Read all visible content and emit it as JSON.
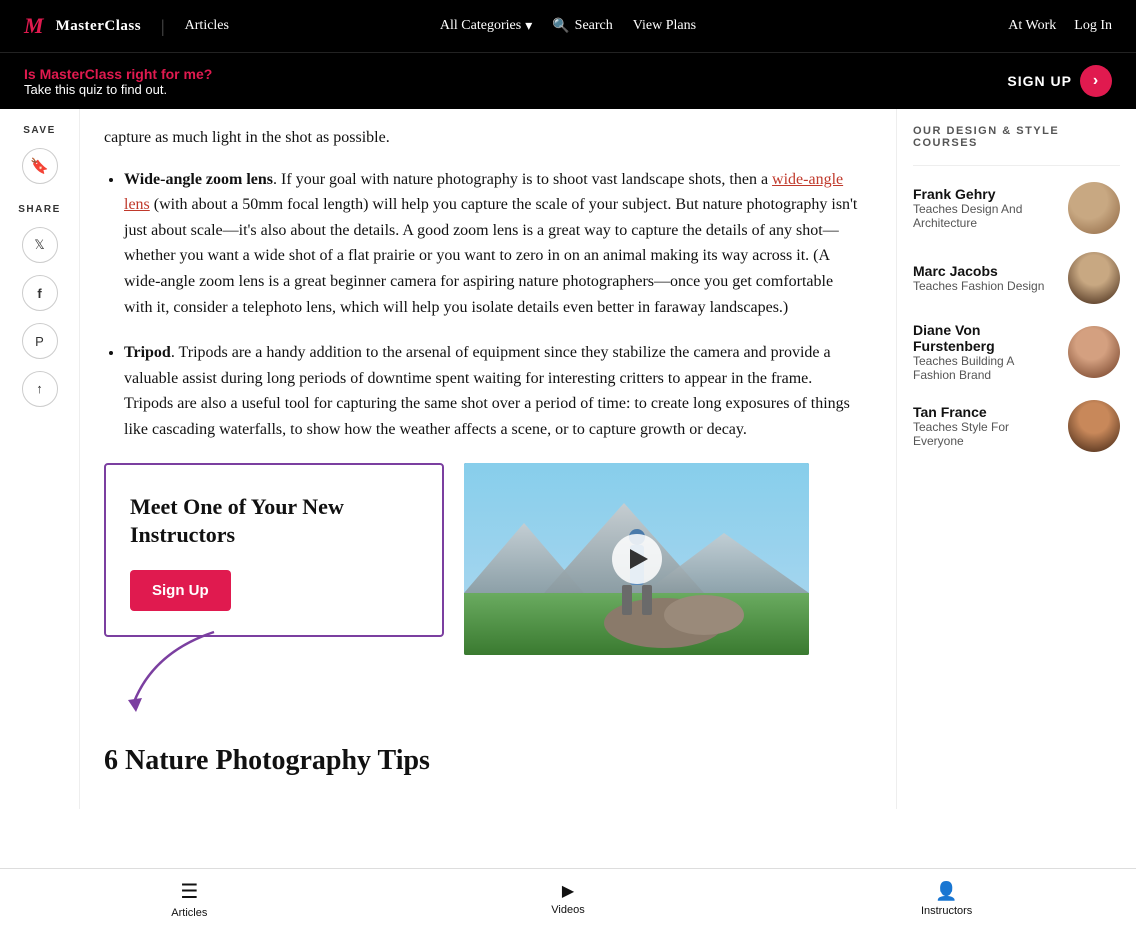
{
  "nav": {
    "logo_m": "M",
    "logo_brand": "MasterClass",
    "logo_divider": "|",
    "logo_section": "Articles",
    "all_categories": "All Categories",
    "search": "Search",
    "view_plans": "View Plans",
    "at_work": "At Work",
    "log_in": "Log In"
  },
  "promo": {
    "question": "Is MasterClass right for me?",
    "subtext": "Take this quiz to find out.",
    "signup_label": "SIGN UP"
  },
  "left_sidebar": {
    "save_label": "SAVE",
    "share_label": "SHARE"
  },
  "article": {
    "items": [
      {
        "title": "Wide-angle zoom lens",
        "body": ". If your goal with nature photography is to shoot vast landscape shots, then a ",
        "link_text": "wide-angle lens",
        "body2": " (with about a 50mm focal length) will help you capture the scale of your subject. But nature photography isn't just about scale—it's also about the details. A good zoom lens is a great way to capture the details of any shot—whether you want a wide shot of a flat prairie or you want to zero in on an animal making its way across it. (A wide-angle zoom lens is a great beginner camera for aspiring nature photographers—once you get comfortable with it, consider a telephoto lens, which will help you isolate details even better in faraway landscapes.)"
      },
      {
        "title": "Tripod",
        "body": ". Tripods are a handy addition to the arsenal of equipment since they stabilize the camera and provide a valuable assist during long periods of downtime spent waiting for interesting critters to appear in the frame. Tripods are also a useful tool for capturing the same shot over a period of time: to create long exposures of things like cascading waterfalls, to show how the weather affects a scene, or to capture growth or decay."
      }
    ],
    "cta_title": "Meet One of Your New Instructors",
    "cta_signup_btn": "Sign Up",
    "section_heading": "6 Nature Photography Tips"
  },
  "right_sidebar": {
    "section_title": "OUR DESIGN & STYLE COURSES",
    "courses": [
      {
        "name": "Frank Gehry",
        "desc": "Teaches Design And Architecture"
      },
      {
        "name": "Marc Jacobs",
        "desc": "Teaches Fashion Design"
      },
      {
        "name": "Diane Von Furstenberg",
        "desc": "Teaches Building A Fashion Brand"
      },
      {
        "name": "Tan France",
        "desc": "Teaches Style For Everyone"
      }
    ]
  },
  "bottom_nav": {
    "items": [
      {
        "label": "Articles",
        "icon": "☰"
      },
      {
        "label": "Videos",
        "icon": "▶"
      },
      {
        "label": "Instructors",
        "icon": "👤"
      }
    ]
  }
}
